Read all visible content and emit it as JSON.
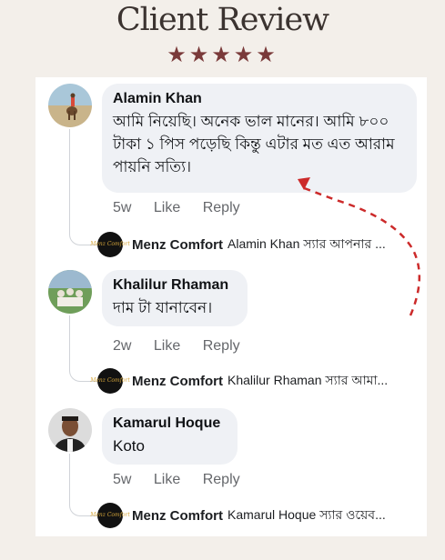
{
  "heading": "Client Review",
  "stars": "★★★★★",
  "comments": [
    {
      "name": "Alamin Khan",
      "text": "আমি নিয়েছি। অনেক ভাল মানের। আমি ৮০০ টাকা ১ পিস পড়েছি কিন্তু এটার মত এত আরাম পায়নি সত্যি।",
      "time": "5w",
      "like": "Like",
      "reply": "Reply",
      "reply_author": "Menz Comfort",
      "reply_preview": "Alamin Khan স্যার আপনার ..."
    },
    {
      "name": "Khalilur Rhaman",
      "text": "দাম টা যানাবেন।",
      "time": "2w",
      "like": "Like",
      "reply": "Reply",
      "reply_author": "Menz Comfort",
      "reply_preview": "Khalilur Rhaman স্যার আমা..."
    },
    {
      "name": "Kamarul Hoque",
      "text": "Koto",
      "time": "5w",
      "like": "Like",
      "reply": "Reply",
      "reply_author": "Menz Comfort",
      "reply_preview": "Kamarul Hoque স্যার ওয়েব..."
    }
  ],
  "brand_logo_text": "Menz Comfort",
  "colors": {
    "star": "#7a3a3a",
    "arrow": "#cc2a2a",
    "bubble": "#eff1f5",
    "meta": "#65676b"
  }
}
